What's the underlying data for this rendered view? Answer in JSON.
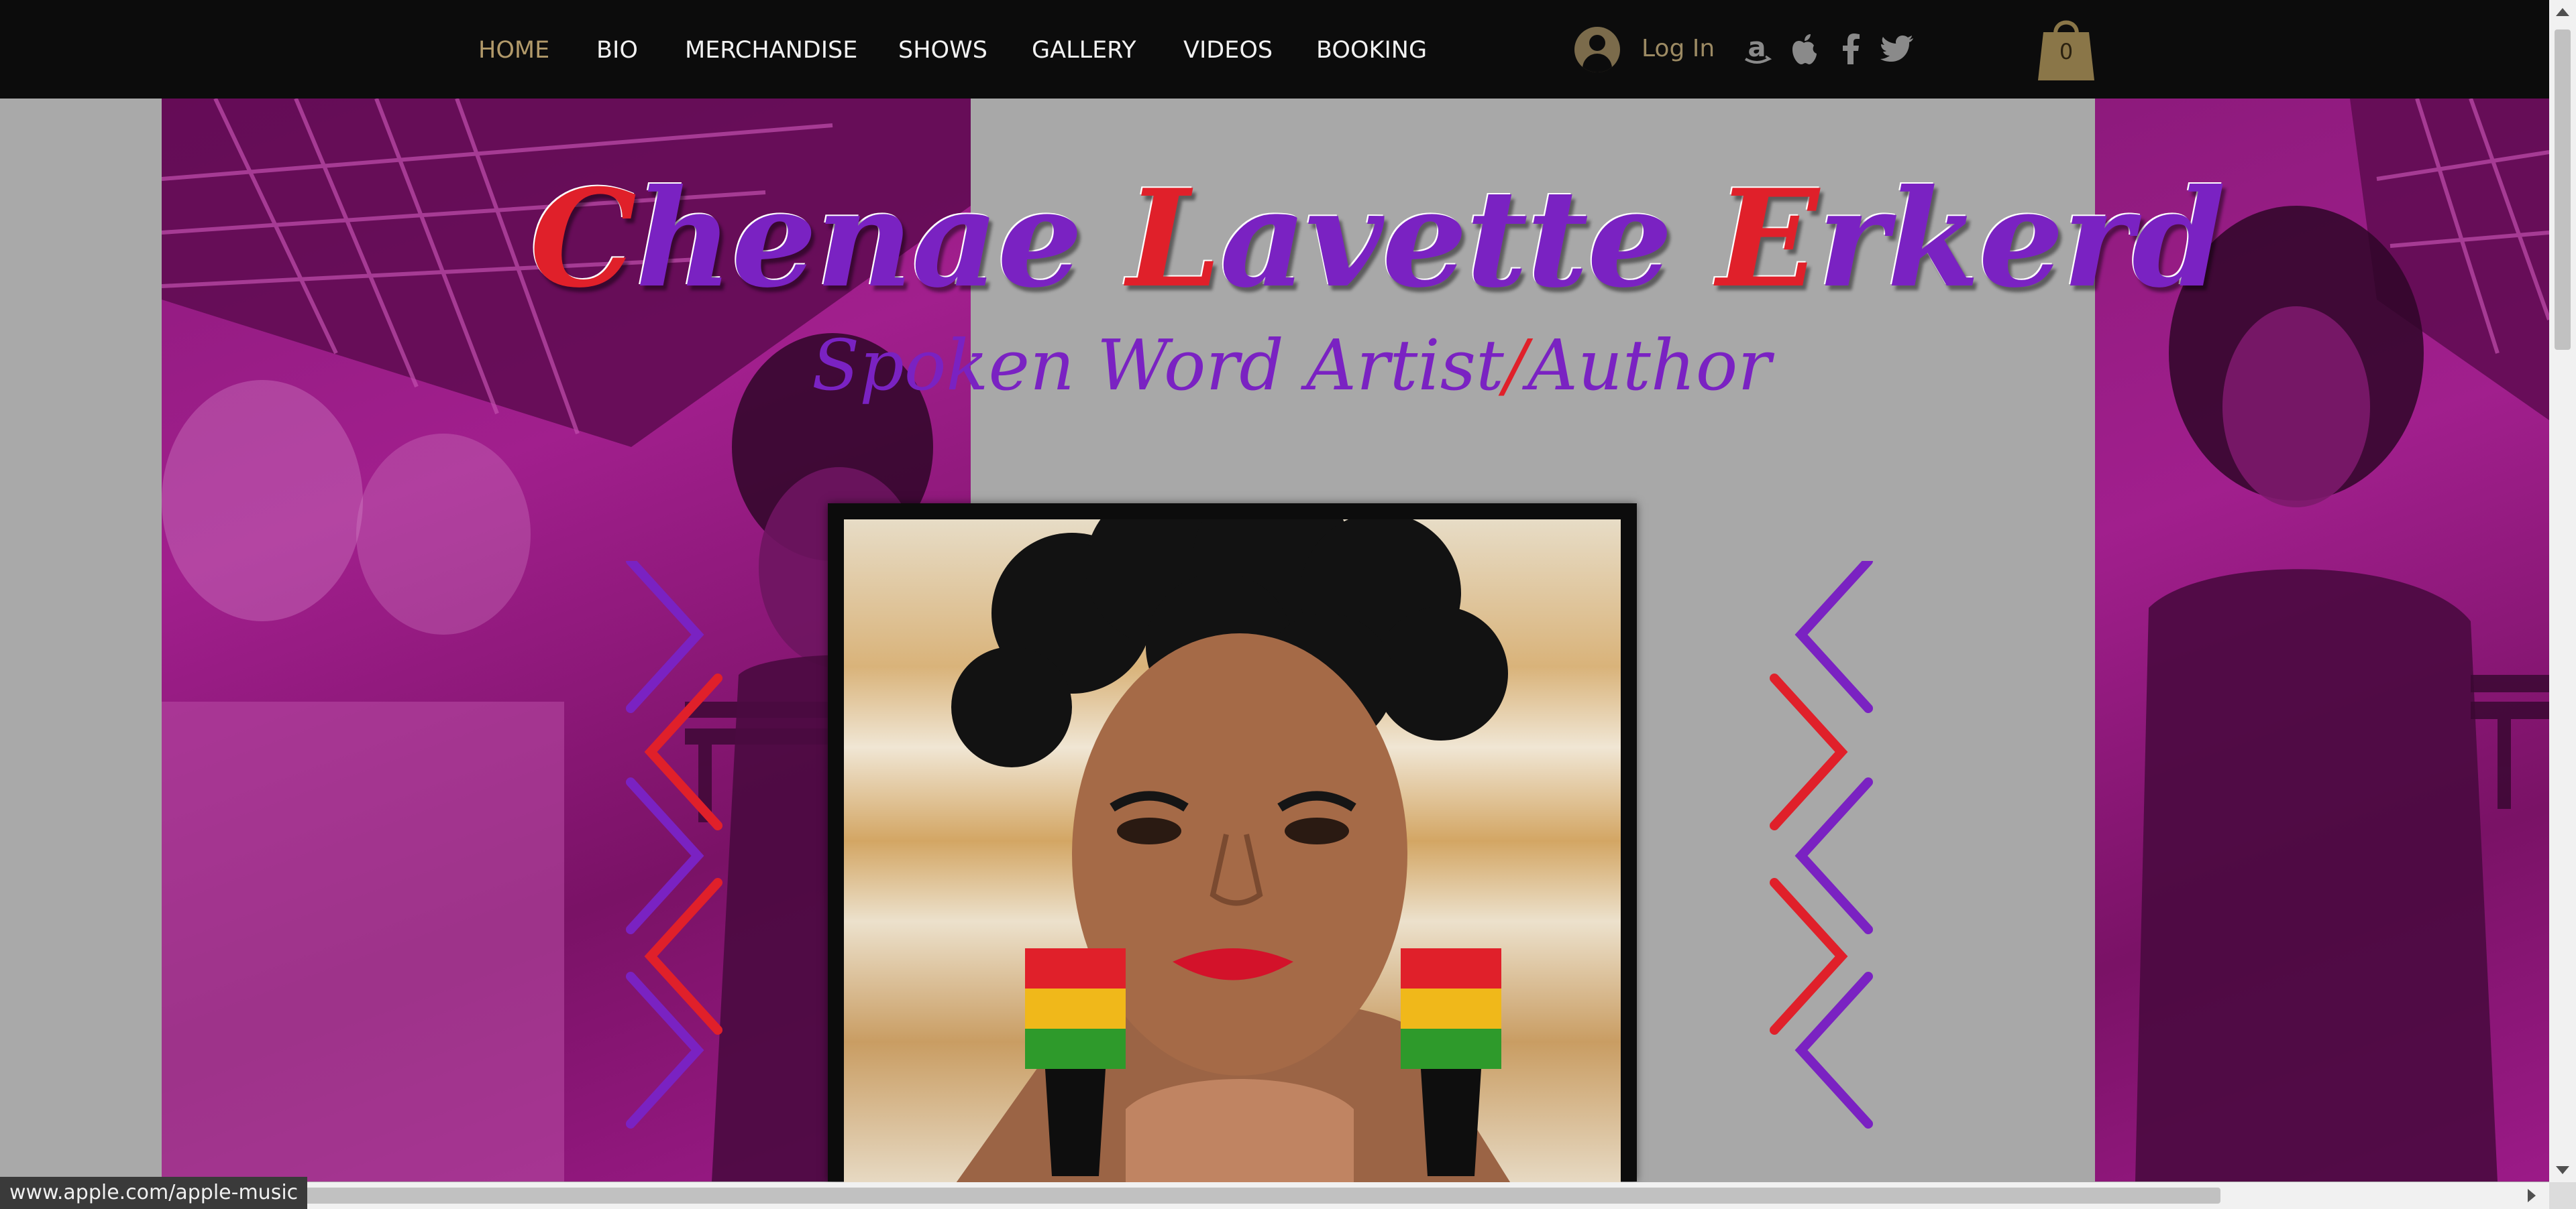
{
  "nav": {
    "items": [
      {
        "label": "HOME",
        "active": true
      },
      {
        "label": "BIO"
      },
      {
        "label": "MERCHANDISE"
      },
      {
        "label": "SHOWS"
      },
      {
        "label": "GALLERY"
      },
      {
        "label": "VIDEOS"
      },
      {
        "label": "BOOKING"
      }
    ],
    "login_label": "Log In",
    "social_icons": [
      "amazon-icon",
      "apple-icon",
      "facebook-icon",
      "twitter-icon"
    ],
    "cart_count": "0"
  },
  "hero": {
    "title_parts": [
      "C",
      "henae ",
      "L",
      "avette ",
      "E",
      "rkerd"
    ],
    "subtitle_part1": "Spoken Word Artist",
    "subtitle_slash": "/",
    "subtitle_part2": "Author"
  },
  "status_url": "www.apple.com/apple-music",
  "colors": {
    "accent_gold": "#b29a6a",
    "title_purple": "#7a22c2",
    "title_red": "#e0202a",
    "panel_magenta": "#9c1a88",
    "nav_bg": "#0c0c0c"
  }
}
